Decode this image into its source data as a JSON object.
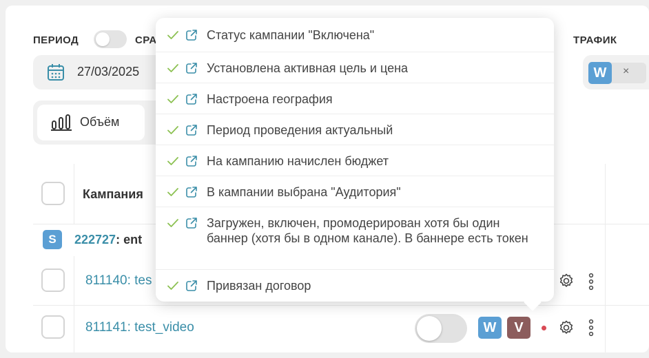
{
  "filters": {
    "period_label": "ПЕРИОД",
    "compare_label": "СРА",
    "date_value": "27/03/2025",
    "traffic_label": "ТРАФИК",
    "traffic_tag": "W",
    "traffic_remove": "×"
  },
  "toolbar": {
    "volume_label": "Объём"
  },
  "table": {
    "header_campaign": "Кампания",
    "group": {
      "badge": "S",
      "id": "222727",
      "name": ": ent"
    },
    "rows": [
      {
        "id": "811140",
        "name": ": tes"
      },
      {
        "id": "811141",
        "name": ": test_video",
        "badges": [
          "W",
          "V"
        ]
      }
    ]
  },
  "popover": {
    "items": [
      "Статус кампании \"Включена\"",
      "Установлена активная цель и цена",
      "Настроена география",
      "Период проведения актуальный",
      "На кампанию начислен бюджет",
      "В кампании выбрана \"Аудитория\"",
      "Загружен, включен, промодерирован хотя бы один баннер (хотя бы в одном канале). В баннере есть токен",
      "Привязан договор"
    ]
  },
  "colors": {
    "accent_link": "#3a8ea8",
    "check_green": "#8cc152",
    "badge_blue": "#5b9fd4",
    "badge_brown": "#8c5c5c",
    "status_dot": "#d94a55"
  }
}
